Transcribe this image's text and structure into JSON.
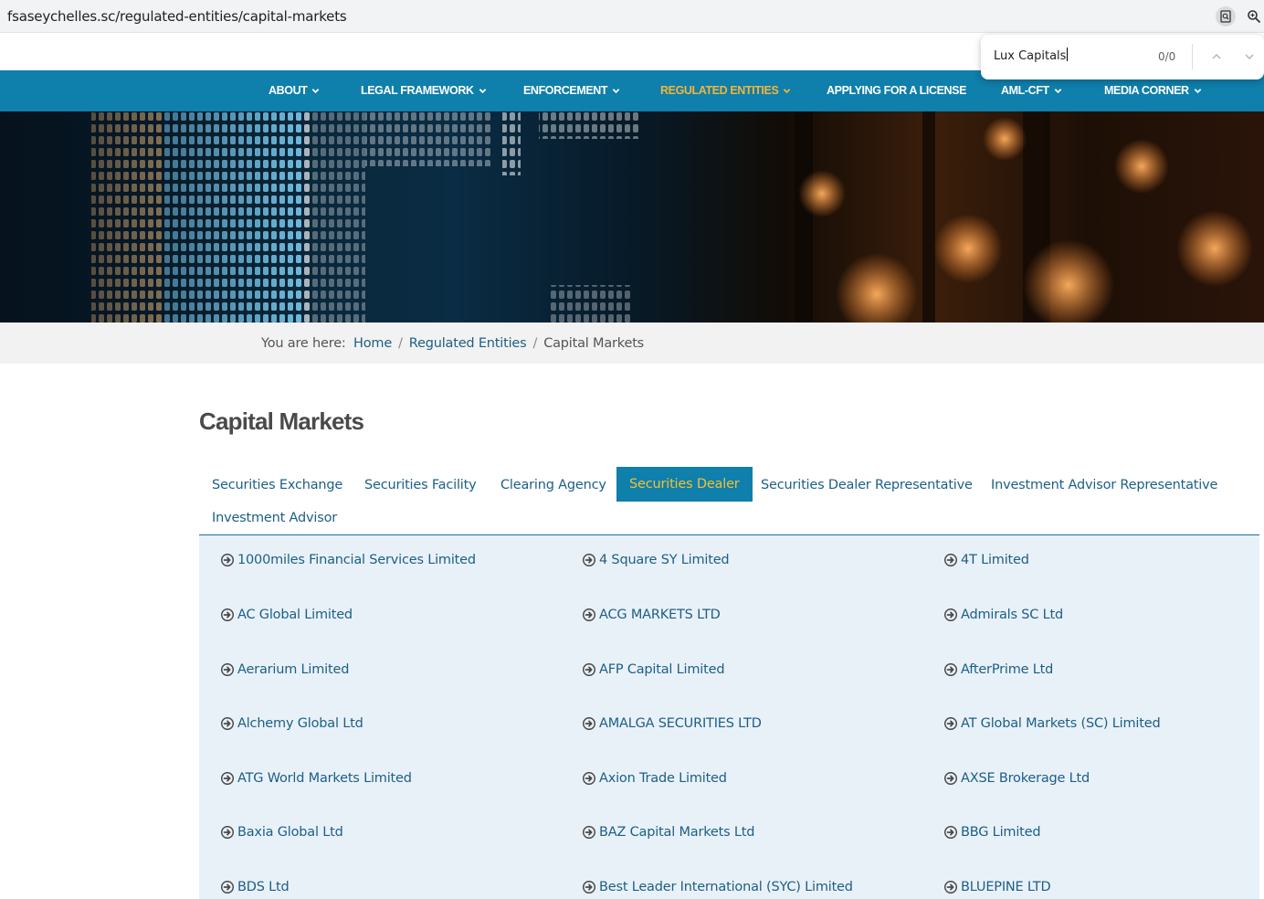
{
  "browser": {
    "url": "fsaseychelles.sc/regulated-entities/capital-markets",
    "find": {
      "query": "Lux Capitals",
      "count": "0/0"
    }
  },
  "nav": {
    "items": [
      {
        "label": "ABOUT",
        "dropdown": true
      },
      {
        "label": "LEGAL FRAMEWORK",
        "dropdown": true
      },
      {
        "label": "ENFORCEMENT",
        "dropdown": true
      },
      {
        "label": "REGULATED ENTITIES",
        "dropdown": true,
        "active": true
      },
      {
        "label": "APPLYING FOR A LICENSE",
        "dropdown": false
      },
      {
        "label": "AML-CFT",
        "dropdown": true
      },
      {
        "label": "MEDIA CORNER",
        "dropdown": true
      }
    ]
  },
  "breadcrumb": {
    "prefix": "You are here:",
    "items": [
      "Home",
      "Regulated Entities",
      "Capital Markets"
    ]
  },
  "page": {
    "title": "Capital Markets"
  },
  "tabs": [
    {
      "label": "Securities Exchange"
    },
    {
      "label": "Securities Facility"
    },
    {
      "label": "Clearing Agency"
    },
    {
      "label": "Securities Dealer",
      "active": true
    },
    {
      "label": "Securities Dealer Representative"
    },
    {
      "label": "Investment Advisor Representative"
    },
    {
      "label": "Investment Advisor"
    }
  ],
  "entities": [
    "1000miles Financial Services Limited",
    "4 Square SY Limited",
    "4T Limited",
    "AC Global Limited",
    "ACG MARKETS LTD",
    "Admirals SC Ltd",
    "Aerarium Limited",
    "AFP Capital Limited",
    "AfterPrime Ltd",
    "Alchemy Global Ltd",
    "AMALGA SECURITIES LTD",
    "AT Global Markets (SC) Limited",
    "ATG World Markets Limited",
    "Axion Trade Limited",
    "AXSE Brokerage Ltd",
    "Baxia Global Ltd",
    "BAZ Capital Markets Ltd",
    "BBG Limited",
    "BDS Ltd",
    "Best Leader International (SYC) Limited",
    "BLUEPINE LTD"
  ],
  "colors": {
    "nav_bg": "#0f7fab",
    "nav_active": "#f3b53a",
    "link": "#1c5f86",
    "panel_bg": "#e9f1f8",
    "tab_active_bg": "#0f7fab",
    "tab_active_text": "#f3c235"
  },
  "icons": {
    "entity_bullet": "circle-arrow-right-icon",
    "nav_dropdown": "chevron-down-icon"
  }
}
